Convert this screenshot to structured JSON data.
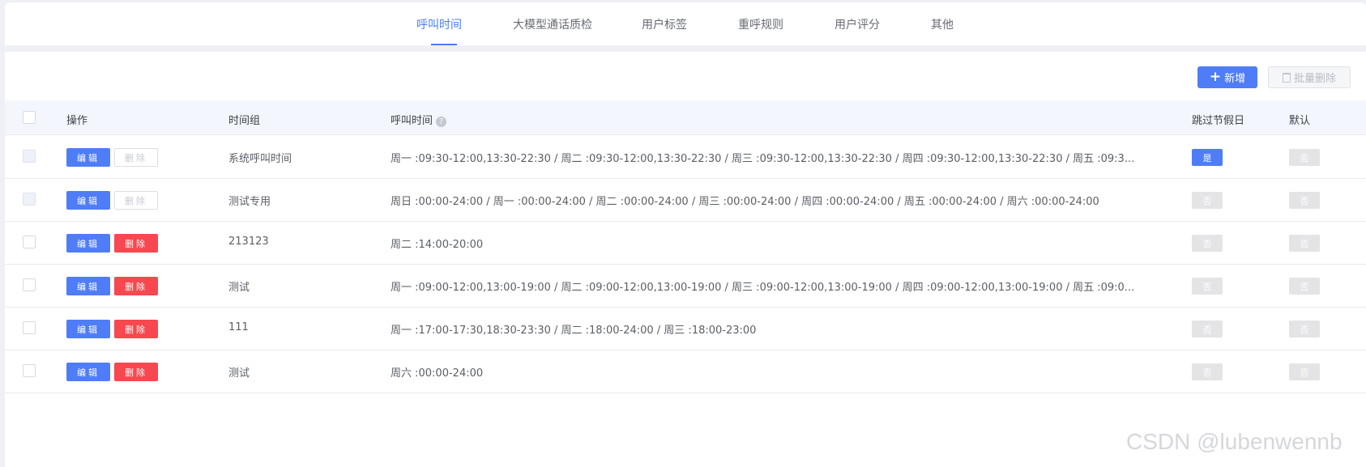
{
  "tabs": [
    {
      "label": "呼叫时间",
      "active": true
    },
    {
      "label": "大模型通话质检",
      "active": false
    },
    {
      "label": "用户标签",
      "active": false
    },
    {
      "label": "重呼规则",
      "active": false
    },
    {
      "label": "用户评分",
      "active": false
    },
    {
      "label": "其他",
      "active": false
    }
  ],
  "toolbar": {
    "add_label": "新增",
    "batch_delete_label": "批量删除"
  },
  "table": {
    "headers": {
      "action": "操作",
      "group": "时间组",
      "time": "呼叫时间",
      "skip_holiday": "跳过节假日",
      "default": "默认"
    },
    "help_icon": "?",
    "edit_label": "编辑",
    "delete_label": "删除",
    "rows": [
      {
        "group": "系统呼叫时间",
        "time": "周一 :09:30-12:00,13:30-22:30 / 周二 :09:30-12:00,13:30-22:30 / 周三 :09:30-12:00,13:30-22:30 / 周四 :09:30-12:00,13:30-22:30 / 周五 :09:3...",
        "skip_holiday": "是",
        "default": "否",
        "delete_disabled": true
      },
      {
        "group": "测试专用",
        "time": "周日 :00:00-24:00 / 周一 :00:00-24:00 / 周二 :00:00-24:00 / 周三 :00:00-24:00 / 周四 :00:00-24:00 / 周五 :00:00-24:00 / 周六 :00:00-24:00",
        "skip_holiday": "否",
        "default": "否",
        "delete_disabled": true
      },
      {
        "group": "213123",
        "time": "周二 :14:00-20:00",
        "skip_holiday": "否",
        "default": "否",
        "delete_disabled": false
      },
      {
        "group": "测试",
        "time": "周一 :09:00-12:00,13:00-19:00 / 周二 :09:00-12:00,13:00-19:00 / 周三 :09:00-12:00,13:00-19:00 / 周四 :09:00-12:00,13:00-19:00 / 周五 :09:0...",
        "skip_holiday": "否",
        "default": "否",
        "delete_disabled": false
      },
      {
        "group": "111",
        "time": "周一 :17:00-17:30,18:30-23:30 / 周二 :18:00-24:00 / 周三 :18:00-23:00",
        "skip_holiday": "否",
        "default": "否",
        "delete_disabled": false
      },
      {
        "group": "测试",
        "time": "周六 :00:00-24:00",
        "skip_holiday": "否",
        "default": "否",
        "delete_disabled": false
      }
    ]
  },
  "watermark": "CSDN @lubenwennb",
  "colors": {
    "accent": "#4f7df7",
    "danger": "#f6484e",
    "tag_off": "#e4e4e6"
  }
}
